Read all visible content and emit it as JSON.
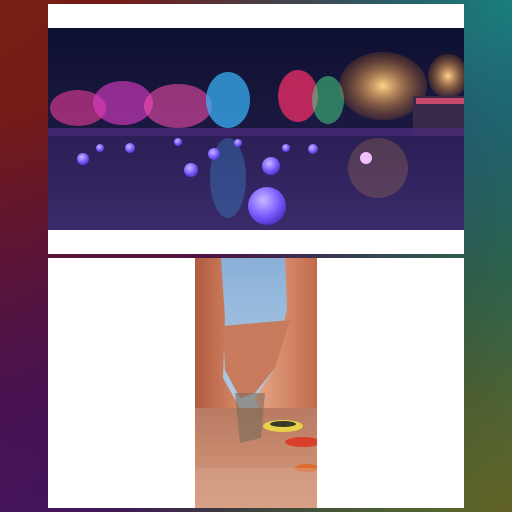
{
  "gallery": {
    "images": [
      {
        "subject": "night-garden-lights",
        "colors": [
          "#1b1a4a",
          "#3a7bff",
          "#ff3fa0",
          "#ffb347",
          "#7a5cff"
        ]
      },
      {
        "subject": "slot-canyon-rafts",
        "colors": [
          "#c9765a",
          "#a8c8e8",
          "#e07a3a",
          "#f2d24a"
        ]
      }
    ]
  }
}
